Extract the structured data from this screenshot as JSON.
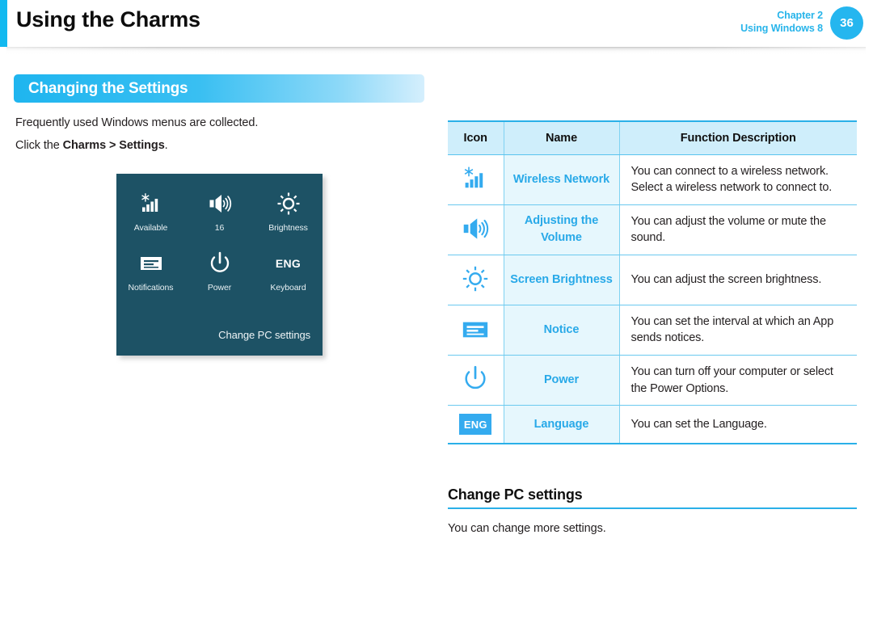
{
  "header": {
    "title": "Using the Charms",
    "chapter": "Chapter 2",
    "subtitle": "Using Windows 8",
    "page_number": "36",
    "accent_color": "#12b9f0",
    "chapter_color": "#27b4ea",
    "page_circle_color": "#25b6ef"
  },
  "section": {
    "banner_title": "Changing the Settings",
    "banner_color": "#1fb5ef",
    "paragraph_1": "Frequently used Windows menus are collected.",
    "paragraph_2_prefix": "Click the ",
    "paragraph_2_bold": "Charms > Settings",
    "paragraph_2_suffix": "."
  },
  "settings_panel": {
    "background_color": "#1d5265",
    "footer_label": "Change PC settings",
    "tiles": [
      {
        "icon": "wireless-network-icon",
        "label": "Available"
      },
      {
        "icon": "volume-icon",
        "label": "16"
      },
      {
        "icon": "brightness-icon",
        "label": "Brightness"
      },
      {
        "icon": "notifications-icon",
        "label": "Notifications"
      },
      {
        "icon": "power-icon",
        "label": "Power"
      },
      {
        "icon": "keyboard-language-icon",
        "label": "Keyboard",
        "icon_text": "ENG"
      }
    ]
  },
  "table": {
    "header_bg": "#cfeefb",
    "name_color": "#28a9e8",
    "columns": [
      "Icon",
      "Name",
      "Function Description"
    ],
    "rows": [
      {
        "icon": "wireless-network-icon",
        "name": "Wireless Network",
        "description": "You can connect to a wireless network. Select a wireless network to connect to."
      },
      {
        "icon": "volume-icon",
        "name": "Adjusting the Volume",
        "description": "You can adjust the volume or mute the sound."
      },
      {
        "icon": "brightness-icon",
        "name": "Screen Brightness",
        "description": "You can adjust the screen brightness."
      },
      {
        "icon": "notice-icon",
        "name": "Notice",
        "description": "You can set the interval at which an App sends notices."
      },
      {
        "icon": "power-icon",
        "name": "Power",
        "description": "You can turn off your computer or select the Power Options."
      },
      {
        "icon": "language-icon",
        "name": "Language",
        "icon_text": "ENG",
        "description": "You can set the Language."
      }
    ]
  },
  "subsection": {
    "title": "Change PC settings",
    "body": "You can change more settings."
  }
}
